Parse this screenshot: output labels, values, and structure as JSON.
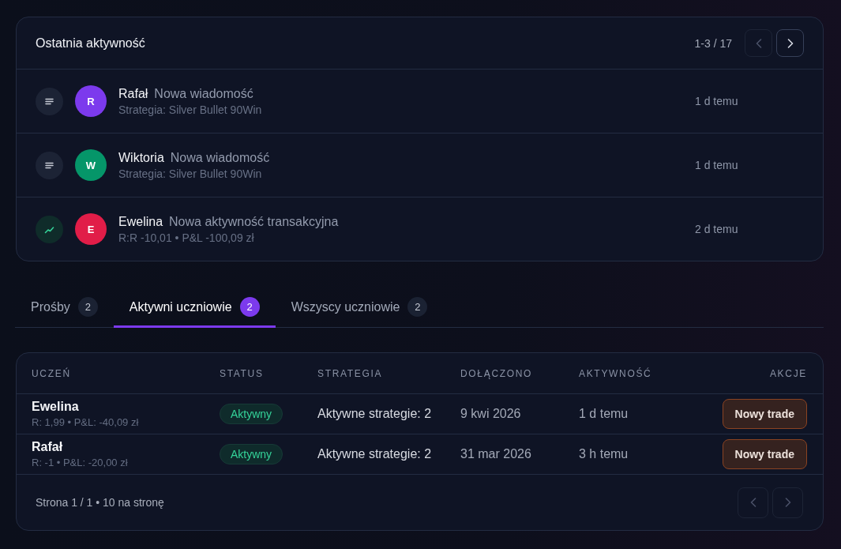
{
  "activity": {
    "title": "Ostatnia aktywność",
    "range": "1-3 / 17",
    "pager": [
      {
        "kind": "prev",
        "disabled": true
      },
      {
        "kind": "next",
        "disabled": false
      }
    ],
    "items": [
      {
        "kind": "message",
        "initial": "R",
        "color": "#7c3aed",
        "name": "Rafał",
        "action": "Nowa wiadomość",
        "detail": "Strategia: Silver Bullet 90Win",
        "time": "1 d temu"
      },
      {
        "kind": "message",
        "initial": "W",
        "color": "#059669",
        "name": "Wiktoria",
        "action": "Nowa wiadomość",
        "detail": "Strategia: Silver Bullet 90Win",
        "time": "1 d temu"
      },
      {
        "kind": "trade",
        "initial": "E",
        "color": "#e11d48",
        "name": "Ewelina",
        "action": "Nowa aktywność transakcyjna",
        "detail": "R:R -10,01 • P&L -100,09 zł",
        "time": "2 d temu"
      }
    ]
  },
  "tabs": [
    {
      "label": "Prośby",
      "count": "2",
      "selected": false
    },
    {
      "label": "Aktywni uczniowie",
      "count": "2",
      "selected": true
    },
    {
      "label": "Wszyscy uczniowie",
      "count": "2",
      "selected": false
    }
  ],
  "table": {
    "columns": [
      "UCZEŃ",
      "STATUS",
      "STRATEGIA",
      "DOŁĄCZONO",
      "AKTYWNOŚĆ",
      "AKCJE"
    ],
    "rows": [
      {
        "name": "Ewelina",
        "stats": "R: 1,99 • P&L: -40,09 zł",
        "status": "Aktywny",
        "strategy": "Aktywne strategie: 2",
        "joined": "9 kwi 2026",
        "activity": "1 d temu",
        "action": "Nowy trade"
      },
      {
        "name": "Rafał",
        "stats": "R: -1 • P&L: -20,00 zł",
        "status": "Aktywny",
        "strategy": "Aktywne strategie: 2",
        "joined": "31 mar 2026",
        "activity": "3 h temu",
        "action": "Nowy trade"
      }
    ],
    "footer": "Strona 1 / 1 • 10 na stronę",
    "pager": [
      {
        "kind": "prev",
        "disabled": true
      },
      {
        "kind": "next",
        "disabled": true
      }
    ]
  }
}
